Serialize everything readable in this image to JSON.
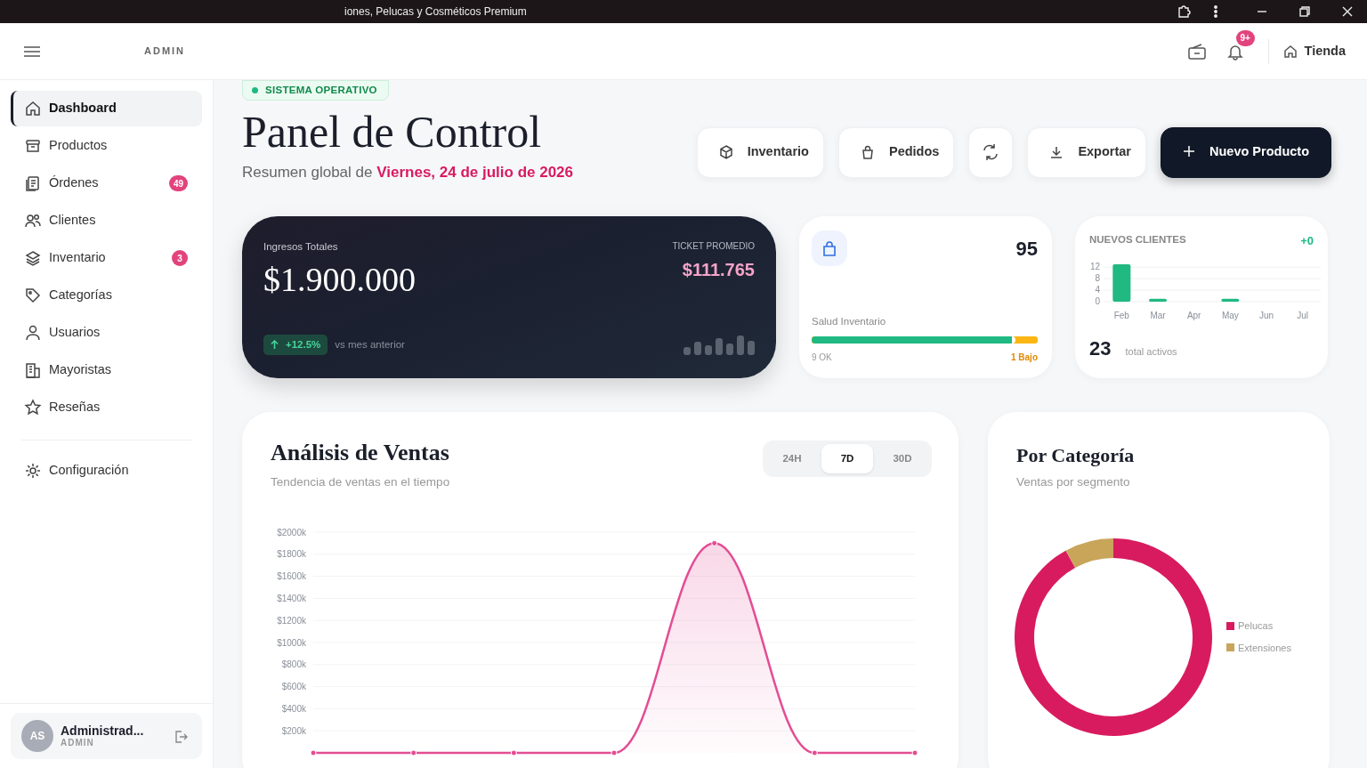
{
  "browser": {
    "title": "iones, Pelucas y Cosméticos Premium"
  },
  "header": {
    "brand": "ADMIN",
    "notification_count": "9+",
    "store_link": "Tienda"
  },
  "sidebar": {
    "items": [
      {
        "label": "Dashboard",
        "selected": true
      },
      {
        "label": "Productos",
        "selected": false
      },
      {
        "label": "Órdenes",
        "badge": "49",
        "selected": false
      },
      {
        "label": "Clientes",
        "selected": false
      },
      {
        "label": "Inventario",
        "badge": "3",
        "selected": false
      },
      {
        "label": "Categorías",
        "selected": false
      },
      {
        "label": "Usuarios",
        "selected": false
      },
      {
        "label": "Mayoristas",
        "selected": false
      },
      {
        "label": "Reseñas",
        "selected": false
      }
    ],
    "settings": {
      "label": "Configuración",
      "selected": false
    },
    "user": {
      "initials": "AS",
      "name": "Administrad...",
      "role": "ADMIN"
    }
  },
  "page": {
    "status": "SISTEMA OPERATIVO",
    "title": "Panel de Control",
    "subtitle": "Resumen global de",
    "date": "Viernes, 24 de julio de 2026",
    "actions": [
      {
        "kind": "outline",
        "label": "Inventario"
      },
      {
        "kind": "outline",
        "label": "Pedidos"
      },
      {
        "kind": "icon"
      },
      {
        "kind": "outline",
        "label": "Exportar"
      },
      {
        "kind": "primary",
        "label": "Nuevo Producto"
      }
    ]
  },
  "revenue": {
    "label": "Ingresos Totales",
    "value": "$1.900.000",
    "ticket_label": "TICKET PROMEDIO",
    "ticket_value": "$111.765",
    "change": "+12.5%",
    "change_note": "vs mes anterior"
  },
  "inventory": {
    "value": "95",
    "label": "Salud Inventario",
    "level": 0.9,
    "ok": "9 OK",
    "low": "1 Bajo"
  },
  "clients": {
    "title": "NUEVOS CLIENTES",
    "change": "+0",
    "total": "23",
    "total_note": "total activos",
    "chart_data": {
      "type": "bar",
      "categories": [
        "Feb",
        "Mar",
        "Apr",
        "May",
        "Jun",
        "Jul"
      ],
      "series": [
        {
          "color": "#1fb981",
          "values": [
            13,
            1,
            0,
            1,
            0,
            0
          ]
        }
      ],
      "ylim": [
        0,
        13
      ],
      "yticks": [
        0,
        4,
        8,
        12
      ],
      "grid": true
    }
  },
  "sales": {
    "title": "Análisis de Ventas",
    "subtitle": "Tendencia de ventas en el tiempo",
    "ranges": [
      {
        "label": "24H",
        "selected": false
      },
      {
        "label": "7D",
        "selected": true
      },
      {
        "label": "30D",
        "selected": false
      }
    ],
    "chart_data": {
      "type": "area",
      "grid": true,
      "series": [
        {
          "color": "#e34d94",
          "values": [
            0,
            0,
            0,
            0,
            1900,
            0,
            0
          ]
        }
      ],
      "ylim": [
        0,
        2000
      ],
      "yticks": [
        {
          "value": 200,
          "label": "$200k"
        },
        {
          "value": 400,
          "label": "$400k"
        },
        {
          "value": 600,
          "label": "$600k"
        },
        {
          "value": 800,
          "label": "$800k"
        },
        {
          "value": 1000,
          "label": "$1000k"
        },
        {
          "value": 1200,
          "label": "$1200k"
        },
        {
          "value": 1400,
          "label": "$1400k"
        },
        {
          "value": 1600,
          "label": "$1600k"
        },
        {
          "value": 1800,
          "label": "$1800k"
        },
        {
          "value": 2000,
          "label": "$2000k"
        }
      ]
    }
  },
  "category": {
    "title": "Por Categoría",
    "subtitle": "Ventas por segmento",
    "chart_data": {
      "type": "donut",
      "categories": [
        "Pelucas",
        "Extensiones"
      ],
      "values": [
        92,
        8
      ]
    },
    "legend": [
      {
        "color": "#d81b5f"
      },
      {
        "color": "#c9a55a"
      }
    ]
  }
}
